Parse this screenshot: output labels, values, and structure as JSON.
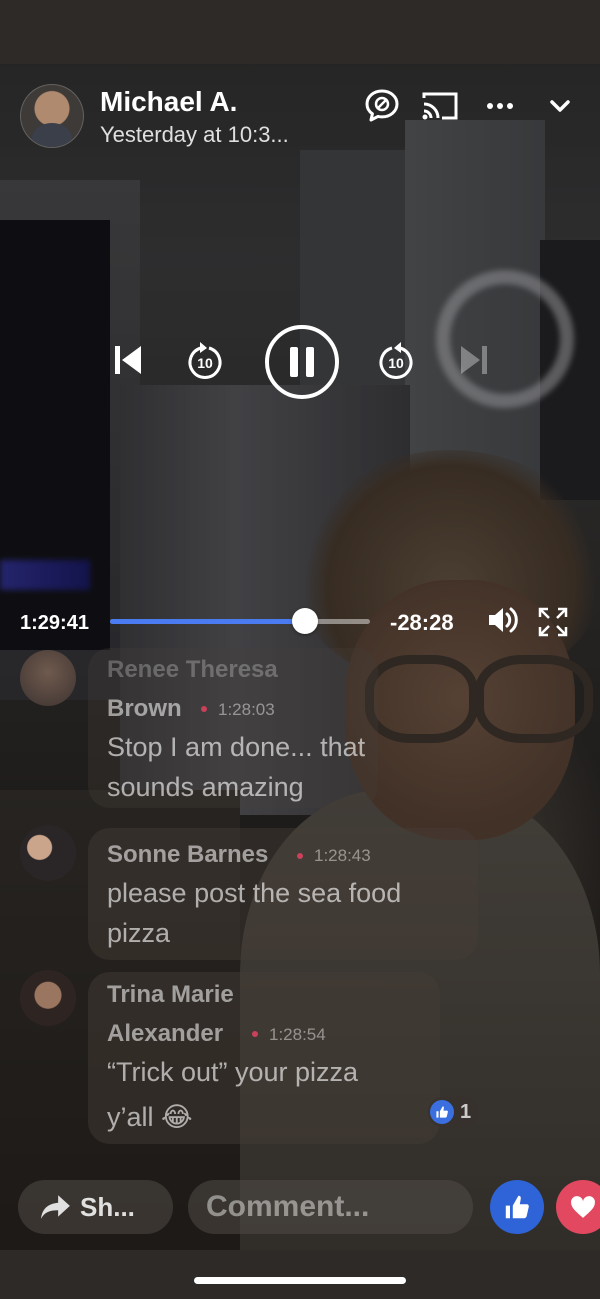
{
  "header": {
    "user_name": "Michael A.",
    "post_time": "Yesterday at 10:3...",
    "icons": [
      "comment-off-icon",
      "cast-icon",
      "more-icon",
      "chevron-down-icon"
    ]
  },
  "player": {
    "elapsed": "1:29:41",
    "remaining": "-28:28",
    "progress": 0.75,
    "skip_back_label": "10",
    "skip_forward_label": "10",
    "accent_color": "#4b7bf0"
  },
  "comments": [
    {
      "name_line1": "Renee Theresa",
      "name_line2": "Brown",
      "time": "1:28:03",
      "text_line1": "Stop I am done... that",
      "text_line2": "sounds amazing"
    },
    {
      "name": "Sonne Barnes",
      "time": "1:28:43",
      "text_line1": "please post the sea food",
      "text_line2": "pizza"
    },
    {
      "name_line1": "Trina Marie",
      "name_line2": "Alexander",
      "time": "1:28:54",
      "text_line1": "“Trick out” your pizza",
      "text_line2": "y’all 😂",
      "reaction_count": "1"
    }
  ],
  "bottom": {
    "share_label": "Sh...",
    "comment_placeholder": "Comment...",
    "like_color": "#2f64d8",
    "love_color": "#e2485f"
  }
}
